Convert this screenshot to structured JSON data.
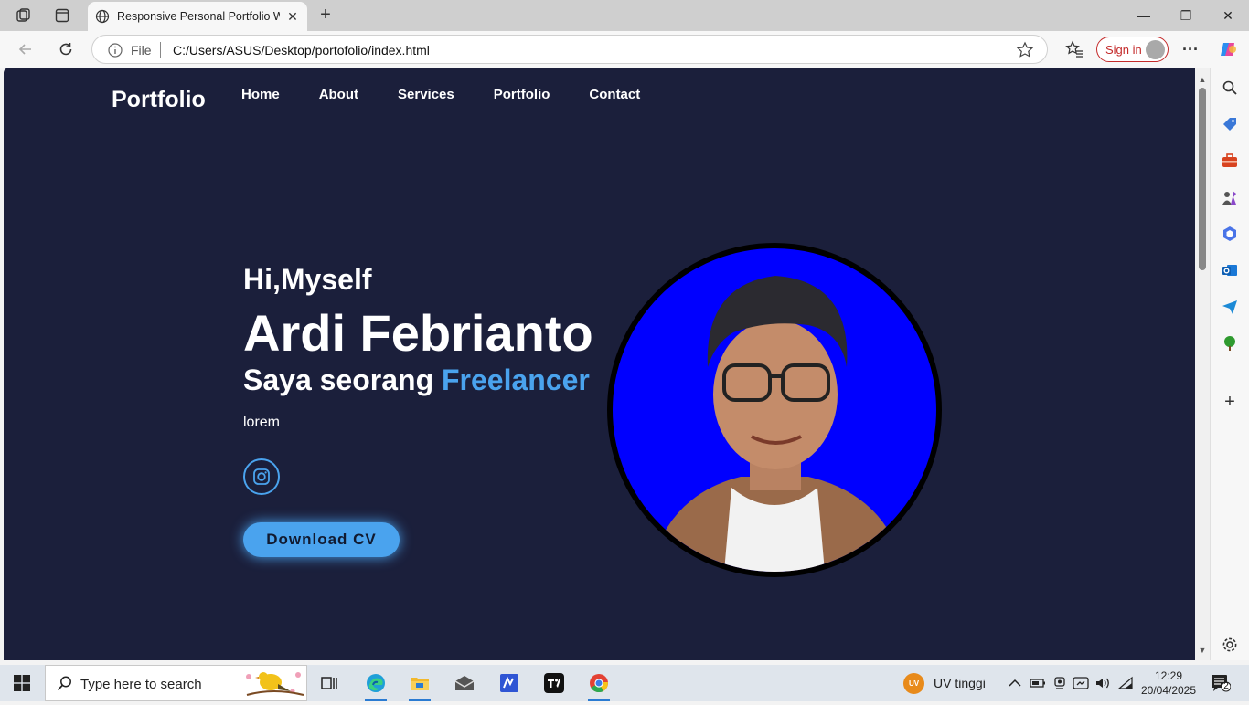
{
  "browser": {
    "tab_title": "Responsive Personal Portfolio We",
    "address_scheme": "File",
    "address_url": "C:/Users/ASUS/Desktop/portofolio/index.html",
    "sign_in_label": "Sign in"
  },
  "page": {
    "logo": "Portfolio",
    "nav": [
      "Home",
      "About",
      "Services",
      "Portfolio",
      "Contact"
    ],
    "greeting": "Hi,Myself",
    "name": "Ardi Febrianto",
    "role_prefix": "Saya seorang",
    "role_highlight": "Freelancer",
    "description": "lorem",
    "cv_button": "Download CV",
    "social_icons": [
      "instagram-icon"
    ],
    "colors": {
      "background": "#1b1f3b",
      "accent": "#4aa3ee",
      "photo_bg": "#0000ff"
    }
  },
  "taskbar": {
    "search_placeholder": "Type here to search",
    "weather_badge": "UV",
    "weather_text": "UV tinggi",
    "time": "12:29",
    "date": "20/04/2025",
    "notification_count": "2"
  }
}
